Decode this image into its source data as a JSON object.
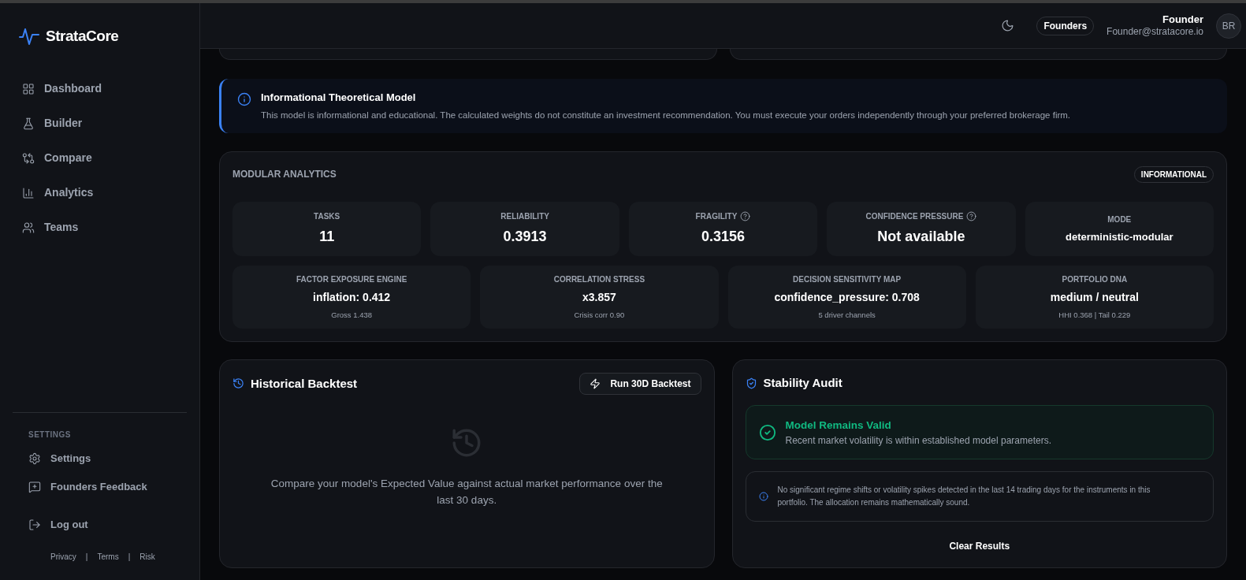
{
  "brand": "StrataCore",
  "nav": [
    {
      "label": "Dashboard"
    },
    {
      "label": "Builder"
    },
    {
      "label": "Compare"
    },
    {
      "label": "Analytics"
    },
    {
      "label": "Teams"
    }
  ],
  "settings_section": {
    "heading": "SETTINGS",
    "items": [
      {
        "label": "Settings"
      },
      {
        "label": "Founders Feedback"
      }
    ]
  },
  "logout": "Log out",
  "footer_links": [
    "Privacy",
    "Terms",
    "Risk"
  ],
  "footer_separator": "|",
  "header": {
    "plan_badge": "Founders",
    "user_name": "Founder",
    "user_email": "Founder@stratacore.io",
    "avatar": "BR"
  },
  "notice": {
    "title": "Informational Theoretical Model",
    "text": "This model is informational and educational. The calculated weights do not constitute an investment recommendation. You must execute your orders independently through your preferred brokerage firm."
  },
  "analytics": {
    "title": "MODULAR ANALYTICS",
    "badge": "INFORMATIONAL",
    "metrics": [
      {
        "label": "TASKS",
        "value": "11",
        "kind": "large",
        "help": false
      },
      {
        "label": "RELIABILITY",
        "value": "0.3913",
        "kind": "large",
        "help": false
      },
      {
        "label": "FRAGILITY",
        "value": "0.3156",
        "kind": "large",
        "help": true
      },
      {
        "label": "CONFIDENCE PRESSURE",
        "value": "Not available",
        "kind": "large",
        "help": true
      },
      {
        "label": "MODE",
        "value": "deterministic-modular",
        "kind": "compact",
        "help": false
      }
    ],
    "engines": [
      {
        "label": "FACTOR EXPOSURE ENGINE",
        "value": "inflation: 0.412",
        "detail": "Gross 1.438"
      },
      {
        "label": "CORRELATION STRESS",
        "value": "x3.857",
        "detail": "Crisis corr 0.90"
      },
      {
        "label": "DECISION SENSITIVITY MAP",
        "value": "confidence_pressure: 0.708",
        "detail": "5 driver channels"
      },
      {
        "label": "PORTFOLIO DNA",
        "value": "medium / neutral",
        "detail": "HHI 0.368 | Tail 0.229"
      }
    ]
  },
  "backtest": {
    "title": "Historical Backtest",
    "button": "Run 30D Backtest",
    "empty_text": "Compare your model's Expected Value against actual market performance over the last 30 days."
  },
  "audit": {
    "title": "Stability Audit",
    "status": {
      "title": "Model Remains Valid",
      "text": "Recent market volatility is within established model parameters.",
      "valid": true
    },
    "note": "No significant regime shifts or volatility spikes detected in the last 14 trading days for the instruments in this portfolio. The allocation remains mathematically sound.",
    "button": "Clear Results"
  }
}
